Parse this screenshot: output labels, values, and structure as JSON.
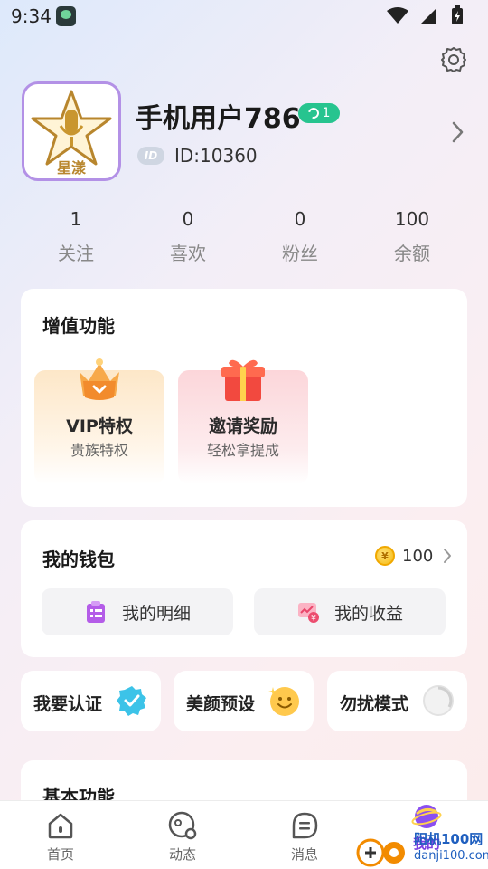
{
  "status_bar": {
    "time": "9:34"
  },
  "profile": {
    "avatar_caption": "星漾",
    "username": "手机用户786",
    "level": "1",
    "id_chip": "ID",
    "id_text": "ID:10360"
  },
  "stats": [
    {
      "value": "1",
      "label": "关注"
    },
    {
      "value": "0",
      "label": "喜欢"
    },
    {
      "value": "0",
      "label": "粉丝"
    },
    {
      "value": "100",
      "label": "余额"
    }
  ],
  "value_added": {
    "title": "增值功能",
    "items": [
      {
        "title": "VIP特权",
        "subtitle": "贵族特权",
        "icon": "crown-icon"
      },
      {
        "title": "邀请奖励",
        "subtitle": "轻松拿提成",
        "icon": "gift-icon"
      }
    ]
  },
  "wallet": {
    "title": "我的钱包",
    "balance": "100",
    "coin_symbol": "¥",
    "detail_label": "我的明细",
    "income_label": "我的收益"
  },
  "quick": {
    "cert_label": "我要认证",
    "beauty_label": "美颜预设",
    "dnd_label": "勿扰模式"
  },
  "basic": {
    "title": "基本功能"
  },
  "nav": {
    "home": "首页",
    "dynamic": "动态",
    "message": "消息",
    "mine": "我的"
  },
  "watermark": {
    "text": "阳机100网",
    "url": "danji100.com"
  },
  "colors": {
    "accent_purple": "#7b3fe0",
    "level_green": "#27c48f",
    "avatar_border": "#b391e6"
  }
}
